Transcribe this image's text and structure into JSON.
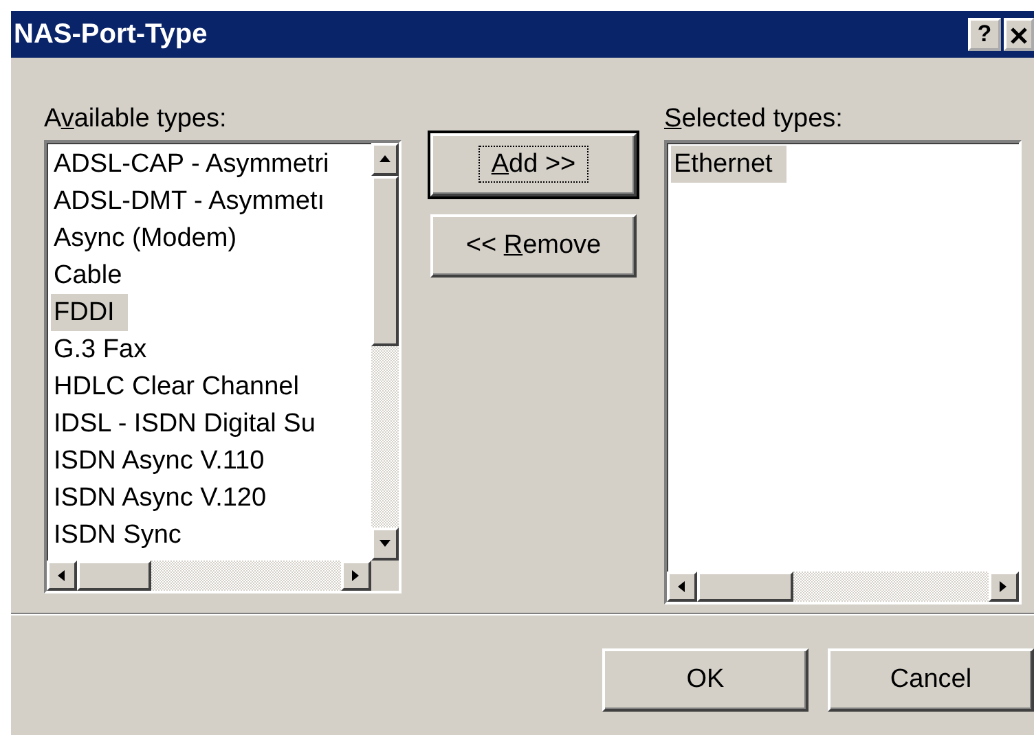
{
  "window": {
    "title": "NAS-Port-Type",
    "help_button": "?"
  },
  "available": {
    "label": {
      "before": "A",
      "key": "v",
      "after": "ailable types:"
    },
    "items": [
      {
        "text": "ADSL-CAP - Asymmetri",
        "selected": false
      },
      {
        "text": "ADSL-DMT - Asymmetı",
        "selected": false
      },
      {
        "text": "Async (Modem)",
        "selected": false
      },
      {
        "text": "Cable",
        "selected": false
      },
      {
        "text": "FDDI",
        "selected": true
      },
      {
        "text": "G.3 Fax",
        "selected": false
      },
      {
        "text": "HDLC Clear Channel",
        "selected": false
      },
      {
        "text": "IDSL - ISDN Digital Su",
        "selected": false
      },
      {
        "text": "ISDN Async V.110",
        "selected": false
      },
      {
        "text": "ISDN Async V.120",
        "selected": false
      },
      {
        "text": "ISDN Sync",
        "selected": false
      }
    ]
  },
  "actions": [
    {
      "label": {
        "key": "A",
        "after": "dd >>"
      },
      "focused": true
    },
    {
      "label": {
        "before": "<< ",
        "key": "R",
        "after": "emove"
      },
      "focused": false
    }
  ],
  "selected": {
    "label": {
      "key": "S",
      "after": "elected types:"
    },
    "items": [
      {
        "text": "Ethernet",
        "selected": true
      }
    ]
  },
  "buttons": [
    "OK",
    "Cancel"
  ]
}
